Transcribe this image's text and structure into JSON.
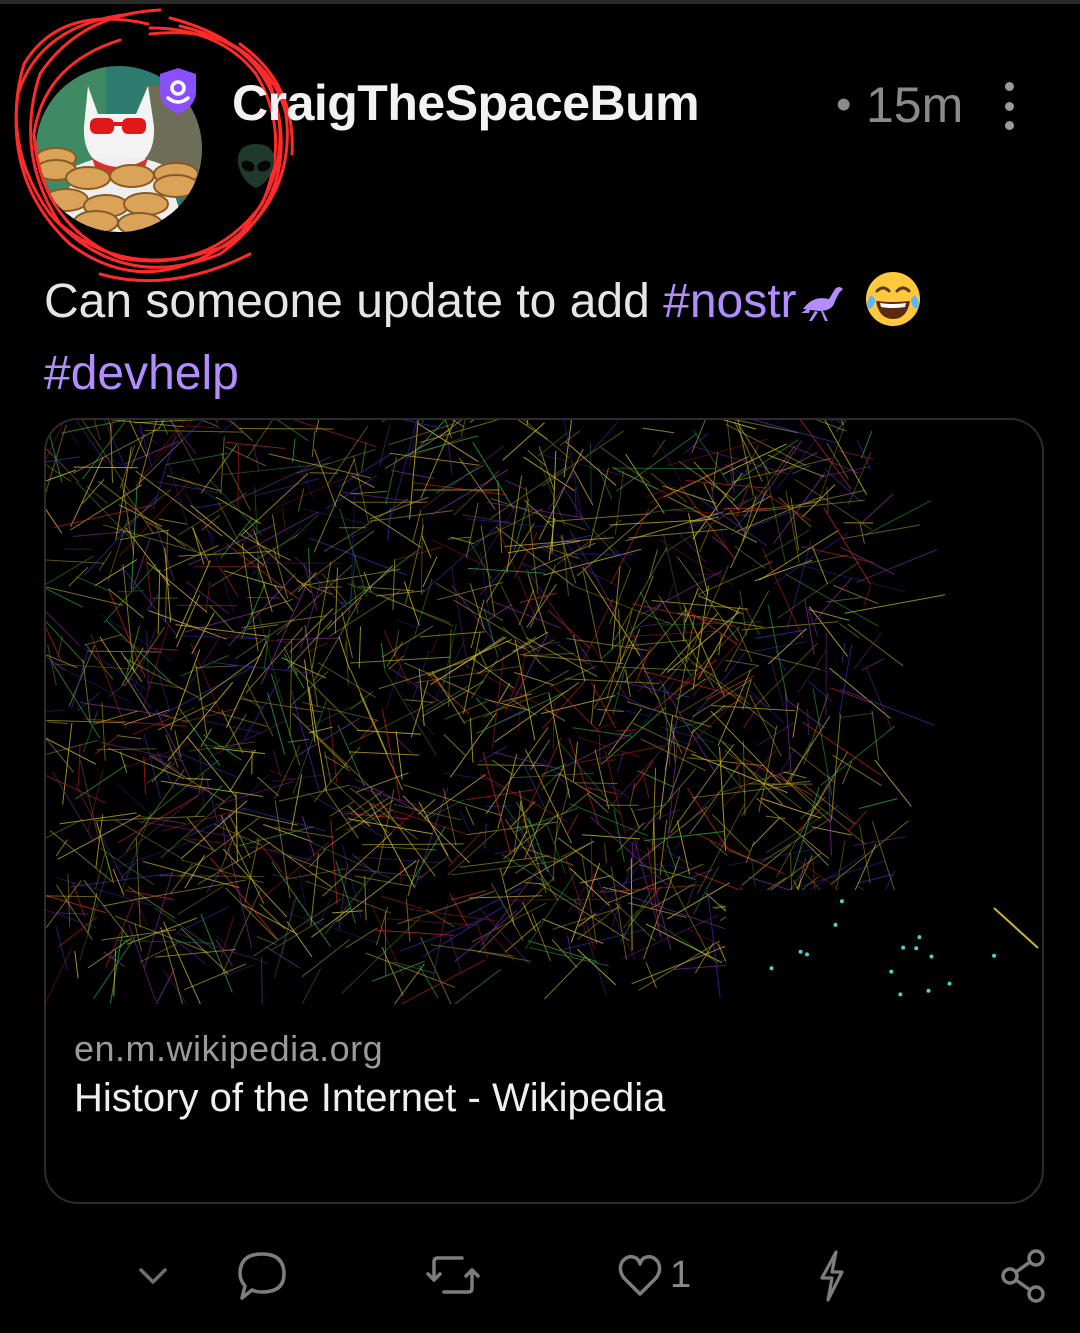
{
  "post": {
    "author": {
      "display_name": "CraigTheSpaceBum",
      "badge_emoji_icon": "alien-icon",
      "verified_icon": "verified-badge-icon"
    },
    "time_separator": "•",
    "timestamp": "15m",
    "content": {
      "text_before": "Can someone update to add ",
      "hashtag_1": "#nostr",
      "hashtag_2": "#devhelp"
    },
    "link_preview": {
      "domain": "en.m.wikipedia.org",
      "title": "History of the Internet - Wikipedia"
    },
    "actions": {
      "like_count": "1"
    }
  },
  "colors": {
    "background": "#000000",
    "hashtag": "#b38cff",
    "muted": "#8a8a8a",
    "verified": "#8a4fff",
    "annotation": "#ff2a2a"
  }
}
